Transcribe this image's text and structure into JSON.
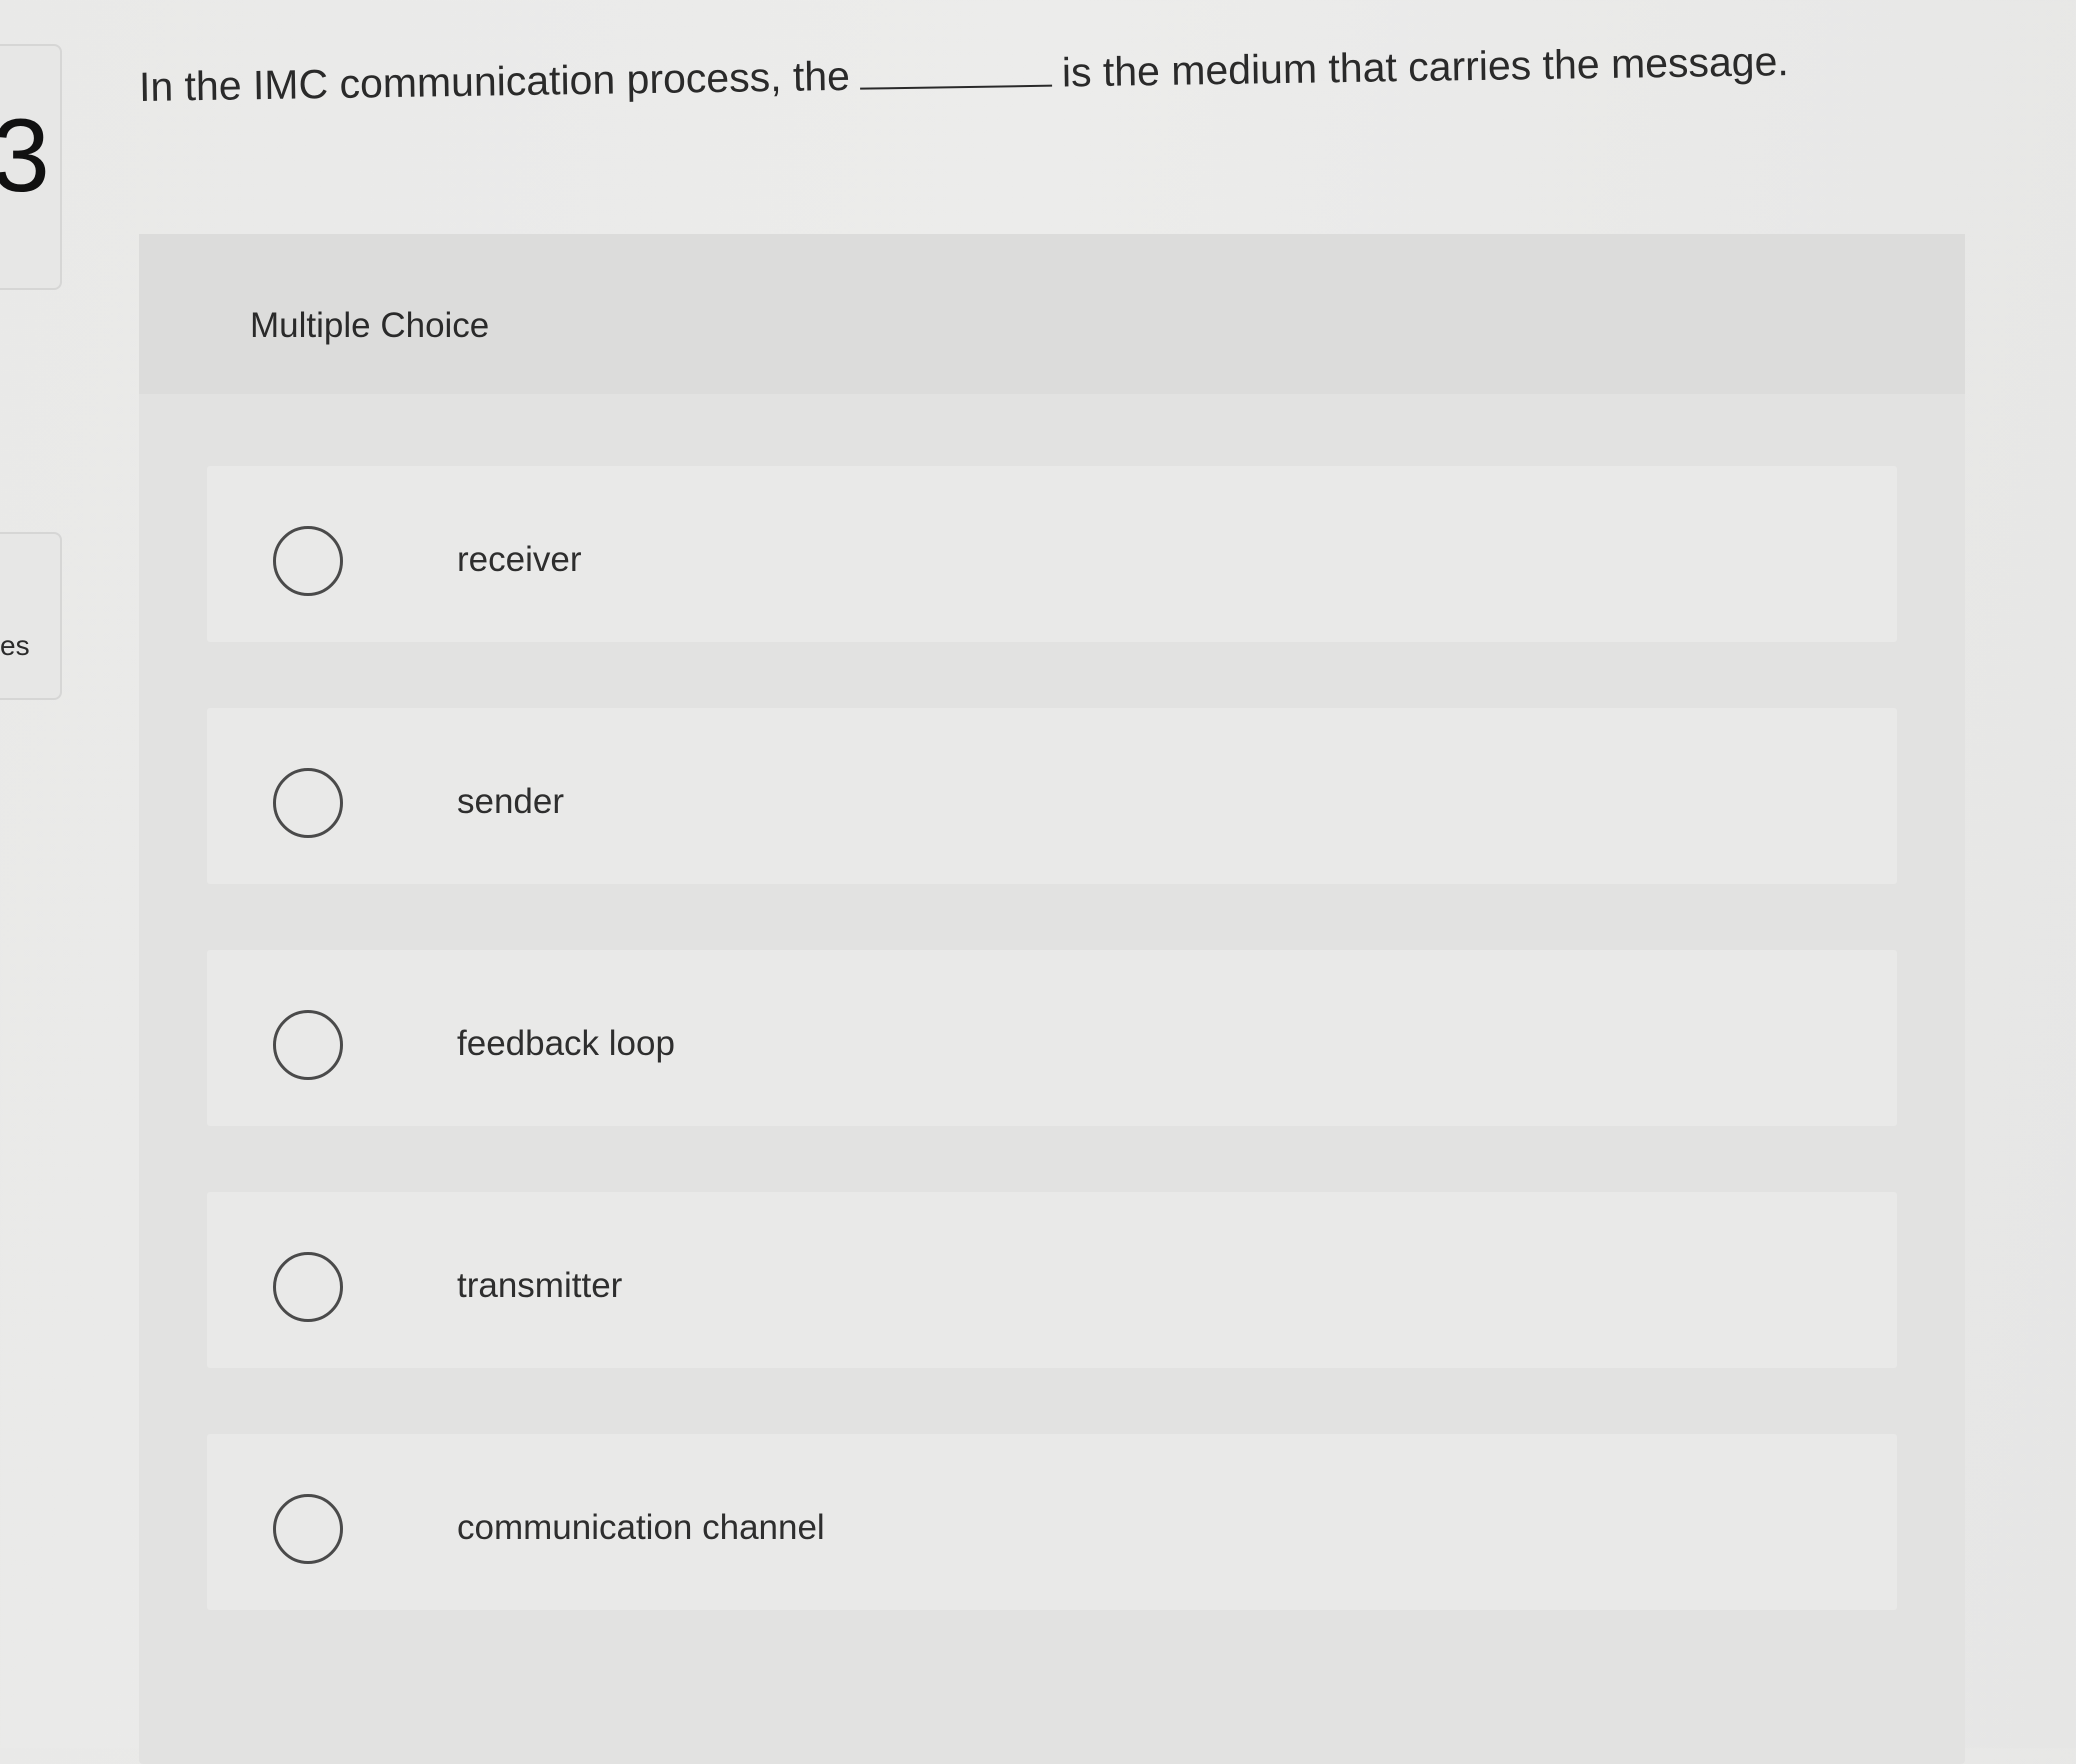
{
  "sidebar": {
    "question_number": "3",
    "bottom_label": "es"
  },
  "question": {
    "text_before": "In the IMC communication process, the",
    "text_after": "is the medium that carries the message."
  },
  "panel": {
    "title": "Multiple Choice"
  },
  "choices": [
    {
      "label": "receiver",
      "selected": false
    },
    {
      "label": "sender",
      "selected": false
    },
    {
      "label": "feedback loop",
      "selected": false
    },
    {
      "label": "transmitter",
      "selected": false
    },
    {
      "label": "communication channel",
      "selected": false
    }
  ]
}
